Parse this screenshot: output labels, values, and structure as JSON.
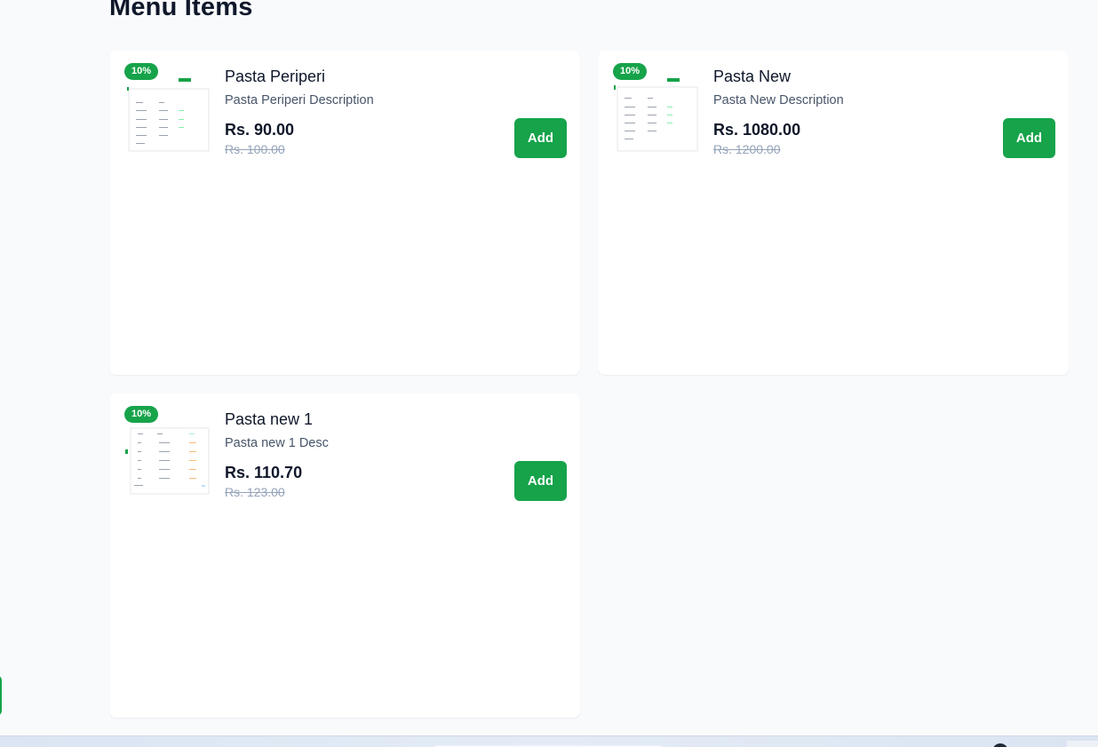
{
  "page": {
    "title": "Menu Items"
  },
  "menu_items": [
    {
      "name": "Pasta Periperi",
      "description": "Pasta Periperi Description",
      "price": "Rs. 90.00",
      "original_price": "Rs. 100.00",
      "discount_badge": "10%",
      "add_label": "Add"
    },
    {
      "name": "Pasta New",
      "description": "Pasta New Description",
      "price": "Rs. 1080.00",
      "original_price": "Rs. 1200.00",
      "discount_badge": "10%",
      "add_label": "Add"
    },
    {
      "name": "Pasta new 1",
      "description": "Pasta new 1 Desc",
      "price": "Rs. 110.70",
      "original_price": "Rs. 123.00",
      "discount_badge": "10%",
      "add_label": "Add"
    }
  ],
  "colors": {
    "accent": "#16a34a",
    "background": "#f8fafc",
    "card": "#ffffff",
    "text": "#0f172a",
    "muted_text": "#475569",
    "strikethrough": "#94a3b8"
  }
}
